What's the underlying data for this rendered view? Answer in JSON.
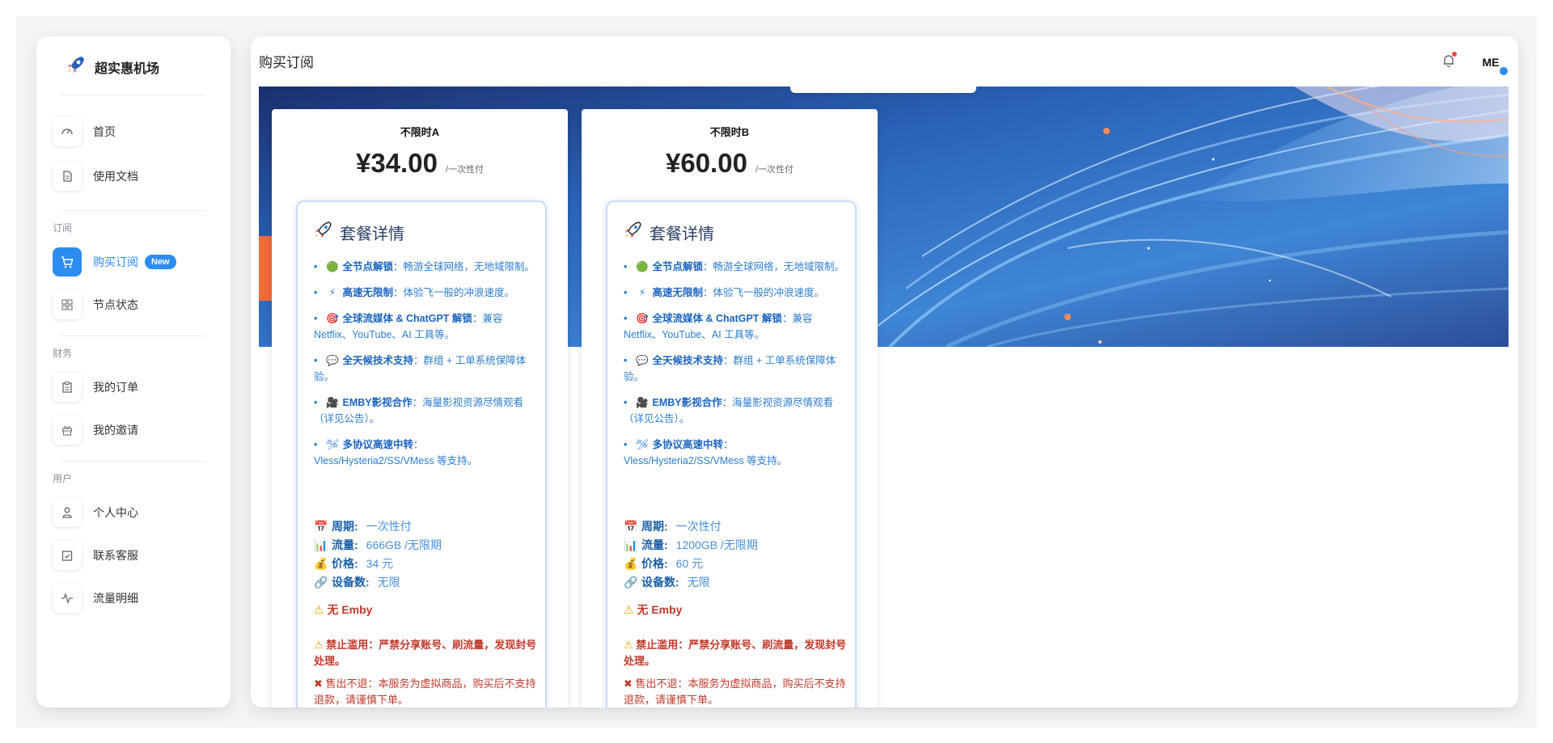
{
  "brand": {
    "name": "超实惠机场"
  },
  "nav": {
    "home": "首页",
    "docs": "使用文档",
    "section_subscribe": "订阅",
    "buy": "购买订阅",
    "buy_badge": "New",
    "nodes": "节点状态",
    "section_finance": "财务",
    "orders": "我的订单",
    "invite": "我的邀请",
    "section_user": "用户",
    "profile": "个人中心",
    "support": "联系客服",
    "traffic": "流量明细"
  },
  "header": {
    "title": "购买订阅",
    "avatar": "ME"
  },
  "colors": {
    "accent": "#2d8cf0",
    "warning": "#c0392b",
    "link": "#2d7dd2"
  },
  "plans": [
    {
      "name": "不限时A",
      "price": "¥34.00",
      "price_unit": "/一次性付",
      "details_title": "套餐详情",
      "features": [
        {
          "icon": "🟢",
          "title": "全节点解锁",
          "text": "：畅游全球网络，无地域限制。"
        },
        {
          "icon": "⚡",
          "title": "高速无限制",
          "text": "：体验飞一般的冲浪速度。"
        },
        {
          "icon": "🎯",
          "title": "全球流媒体 & ChatGPT 解锁",
          "text": "：兼容 Netflix、YouTube、AI 工具等。"
        },
        {
          "icon": "💬",
          "title": "全天候技术支持",
          "text": "：群组 + 工单系统保障体验。"
        },
        {
          "icon": "🎥",
          "title": "EMBY影视合作",
          "text": "：海量影视资源尽情观看（详见公告）。"
        },
        {
          "icon": "🛩",
          "title": "多协议高速中转",
          "text": "：Vless/Hysteria2/SS/VMess 等支持。"
        }
      ],
      "specs": {
        "period_label": "周期:",
        "period": "一次性付",
        "traffic_label": "流量:",
        "traffic": "666GB /无限期",
        "price_label": "价格:",
        "price": "34 元",
        "devices_label": "设备数:",
        "devices": "无限"
      },
      "warn_emby": "无 Emby",
      "warn_abuse": "禁止滥用：严禁分享账号、刷流量，发现封号处理。",
      "no_refund": "售出不退：本服务为虚拟商品，购买后不支持退款，请谨慎下单。"
    },
    {
      "name": "不限时B",
      "price": "¥60.00",
      "price_unit": "/一次性付",
      "details_title": "套餐详情",
      "features": [
        {
          "icon": "🟢",
          "title": "全节点解锁",
          "text": "：畅游全球网络，无地域限制。"
        },
        {
          "icon": "⚡",
          "title": "高速无限制",
          "text": "：体验飞一般的冲浪速度。"
        },
        {
          "icon": "🎯",
          "title": "全球流媒体 & ChatGPT 解锁",
          "text": "：兼容 Netflix、YouTube、AI 工具等。"
        },
        {
          "icon": "💬",
          "title": "全天候技术支持",
          "text": "：群组 + 工单系统保障体验。"
        },
        {
          "icon": "🎥",
          "title": "EMBY影视合作",
          "text": "：海量影视资源尽情观看（详见公告）。"
        },
        {
          "icon": "🛩",
          "title": "多协议高速中转",
          "text": "：Vless/Hysteria2/SS/VMess 等支持。"
        }
      ],
      "specs": {
        "period_label": "周期:",
        "period": "一次性付",
        "traffic_label": "流量:",
        "traffic": "1200GB /无限期",
        "price_label": "价格:",
        "price": "60 元",
        "devices_label": "设备数:",
        "devices": "无限"
      },
      "warn_emby": "无 Emby",
      "warn_abuse": "禁止滥用：严禁分享账号、刷流量，发现封号处理。",
      "no_refund": "售出不退：本服务为虚拟商品，购买后不支持退款，请谨慎下单。"
    }
  ]
}
